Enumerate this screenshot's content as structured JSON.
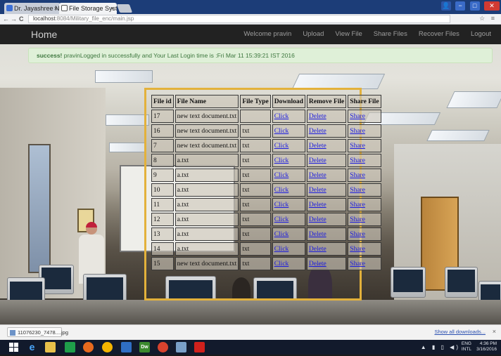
{
  "browser": {
    "tabs": [
      {
        "label": "Dr. Jayashree Nagesh",
        "close": "×"
      },
      {
        "label": "File Storage System",
        "close": "×"
      }
    ],
    "nav": {
      "back": "←",
      "forward": "→",
      "reload": "C"
    },
    "url": {
      "host": "localhost",
      "path": ":8084/Military_file_enc/main.jsp"
    },
    "window_controls": {
      "user": "👤",
      "minimize": "−",
      "maximize": "□",
      "close": "✕"
    },
    "toolbar_icons": "☆ ≡"
  },
  "app": {
    "brand": "Home",
    "nav": [
      "Welcome pravin",
      "Upload",
      "View File",
      "Share Files",
      "Recover Files",
      "Logout"
    ]
  },
  "alert": {
    "strong": "success!",
    "message": " pravinLogged in successfully and Your Last Login time is :Fri Mar 11 15:39:21 IST 2016"
  },
  "table": {
    "headers": [
      "File id",
      "File Name",
      "File Type",
      "Download",
      "Remove File",
      "Share File"
    ],
    "rows": [
      {
        "id": "17",
        "name": "new text document.txt",
        "type": "",
        "download": "Click",
        "remove": "Delete",
        "share": "Share"
      },
      {
        "id": "16",
        "name": "new text document.txt",
        "type": "txt",
        "download": "Click",
        "remove": "Delete",
        "share": "Share"
      },
      {
        "id": "7",
        "name": "new text document.txt",
        "type": "txt",
        "download": "Click",
        "remove": "Delete",
        "share": "Share"
      },
      {
        "id": "8",
        "name": "a.txt",
        "type": "txt",
        "download": "Click",
        "remove": "Delete",
        "share": "Share"
      },
      {
        "id": "9",
        "name": "a.txt",
        "type": "txt",
        "download": "Click",
        "remove": "Delete",
        "share": "Share"
      },
      {
        "id": "10",
        "name": "a.txt",
        "type": "txt",
        "download": "Click",
        "remove": "Delete",
        "share": "Share"
      },
      {
        "id": "11",
        "name": "a.txt",
        "type": "txt",
        "download": "Click",
        "remove": "Delete",
        "share": "Share"
      },
      {
        "id": "12",
        "name": "a.txt",
        "type": "txt",
        "download": "Click",
        "remove": "Delete",
        "share": "Share"
      },
      {
        "id": "13",
        "name": "a.txt",
        "type": "txt",
        "download": "Click",
        "remove": "Delete",
        "share": "Share"
      },
      {
        "id": "14",
        "name": "a.txt",
        "type": "txt",
        "download": "Click",
        "remove": "Delete",
        "share": "Share"
      },
      {
        "id": "15",
        "name": "new text document.txt",
        "type": "txt",
        "download": "Click",
        "remove": "Delete",
        "share": "Share"
      }
    ]
  },
  "downloads": {
    "item": "11076230_7478....jpg",
    "show_all": "Show all downloads...",
    "close": "×"
  },
  "taskbar": {
    "icons": [
      "windows-start",
      "internet-explorer",
      "file-explorer",
      "windows-store",
      "firefox",
      "chrome",
      "netbeans",
      "dreamweaver",
      "headphones-app",
      "paint",
      "acrobat"
    ],
    "dreamweaver_label": "Dw",
    "tray_icons": "▲ ▮ ▯ ◀)",
    "lang_top": "ENG",
    "lang_bottom": "INTL",
    "time": "4:36 PM",
    "date": "3/16/2016"
  }
}
